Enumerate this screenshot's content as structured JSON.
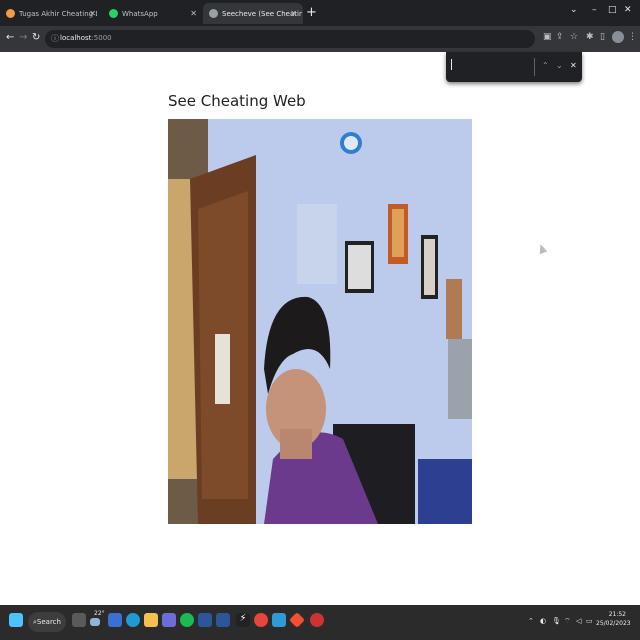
{
  "browser": {
    "tabs": [
      {
        "title": "Tugas Akhir Cheating Detection...",
        "active": false,
        "favicon_color": "#f2994a",
        "icon": "site-favicon"
      },
      {
        "title": "WhatsApp",
        "active": false,
        "favicon_color": "#25d366",
        "icon": "whatsapp-icon"
      },
      {
        "title": "Seecheve (See Cheating Web)",
        "active": true,
        "favicon_color": "#9aa0a6",
        "icon": "globe-icon"
      }
    ],
    "address": {
      "host": "localhost",
      "port": ":5000"
    },
    "find_bar": {
      "value": ""
    },
    "colors": {
      "tab_strip": "#202124",
      "toolbar": "#35363a"
    }
  },
  "page": {
    "heading": "See Cheating Web",
    "video_feed": {
      "label": "webcam-stream"
    }
  },
  "taskbar": {
    "search_label": "Search",
    "temperature": "22°",
    "time": "21:52",
    "date": "25/02/2023",
    "apps": [
      "file-explorer-icon",
      "edge-icon",
      "folder-icon",
      "store-icon",
      "spotify-icon",
      "word-icon",
      "chrome-icon",
      "vscode-icon",
      "git-icon",
      "media-icon"
    ]
  }
}
